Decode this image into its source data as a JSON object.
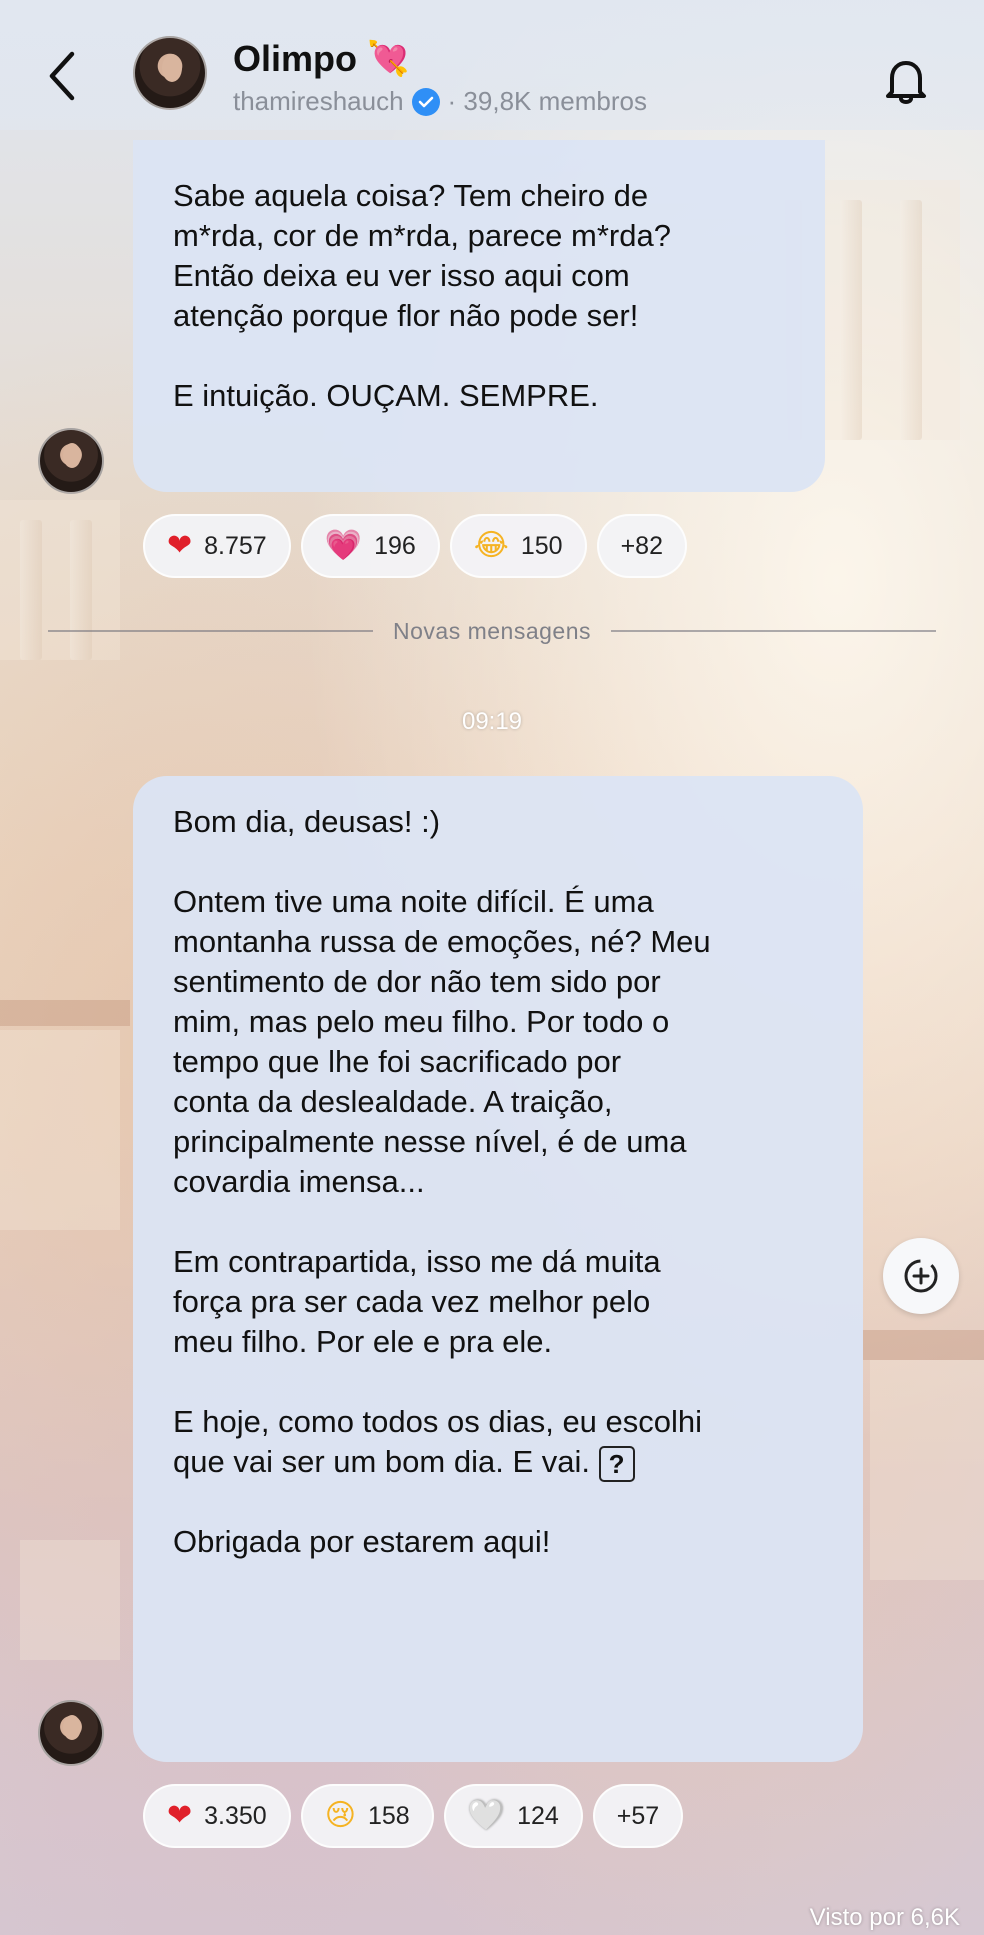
{
  "header": {
    "title": "Olimpo",
    "title_emoji": "💘",
    "username": "thamireshauch",
    "members": "· 39,8K membros",
    "back_icon": "chevron-left-icon",
    "bell_icon": "bell-icon",
    "verified_icon": "verified-badge-icon",
    "verified_color": "#2f8ff6"
  },
  "messages": [
    {
      "paragraphs": [
        "Sabe aquela coisa? Tem cheiro de\nm*rda, cor de m*rda, parece m*rda?\nEntão deixa eu ver isso aqui com\natenção porque flor não pode ser!",
        "E intuição. OUÇAM. SEMPRE."
      ],
      "reactions": [
        {
          "emoji": "❤",
          "count": "8.757"
        },
        {
          "emoji": "💗",
          "count": "196"
        },
        {
          "emoji": "😂",
          "count": "150"
        },
        {
          "count": "+82"
        }
      ]
    },
    {
      "paragraphs": [
        "Bom dia, deusas! :)",
        "Ontem tive uma noite difícil. É uma\nmontanha russa de emoções, né? Meu\nsentimento de dor não tem sido por\nmim, mas pelo meu filho. Por todo o\ntempo que lhe foi sacrificado por\nconta da deslealdade. A traição,\nprincipalmente nesse nível, é de uma\ncovardia imensa...",
        "Em contrapartida, isso me dá muita\nforça pra ser cada vez melhor pelo\nmeu filho. Por ele e pra ele.",
        "E hoje, como todos os dias, eu escolhi\nque vai ser um bom dia. E vai.",
        "Obrigada por estarem aqui!"
      ],
      "missing_glyph": "?",
      "reactions": [
        {
          "emoji": "❤",
          "count": "3.350"
        },
        {
          "emoji": "😢",
          "count": "158"
        },
        {
          "emoji": "🤍",
          "count": "124"
        },
        {
          "count": "+57"
        }
      ]
    }
  ],
  "divider_label": "Novas mensagens",
  "timestamp": "09:19",
  "seen_label": "Visto por 6,6K",
  "colors": {
    "bubble": "#dce4f4",
    "accent_heart": "#e0202a"
  }
}
